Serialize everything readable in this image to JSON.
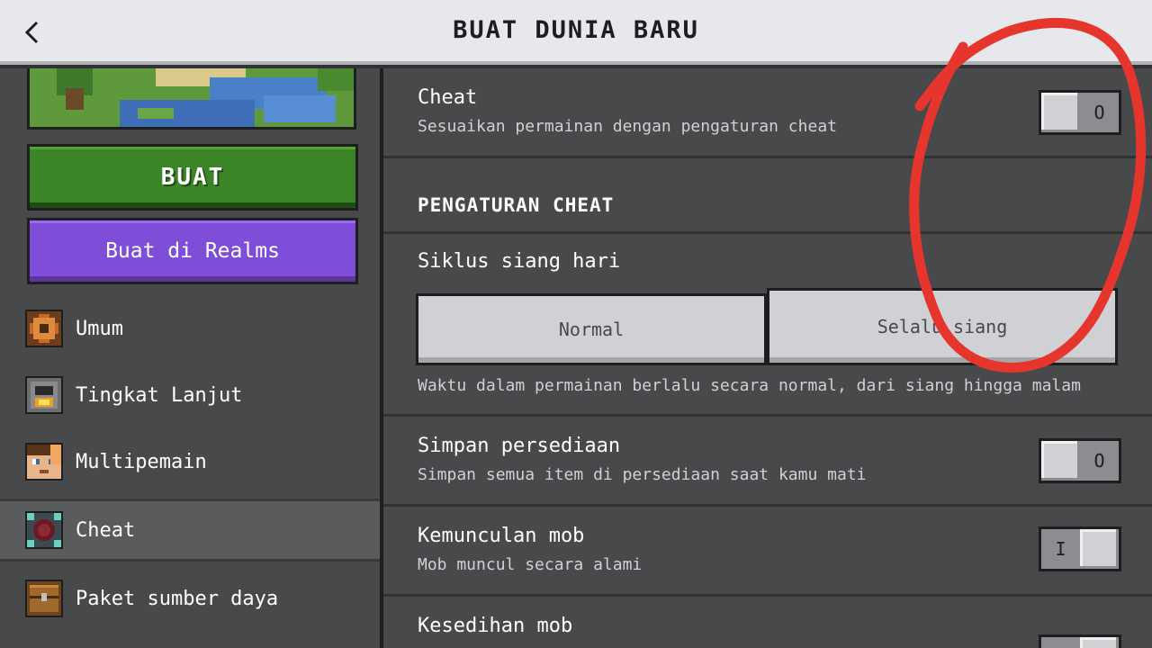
{
  "header": {
    "title": "BUAT DUNIA BARU",
    "back_icon": "chevron-left-icon"
  },
  "sidebar": {
    "create_label": "BUAT",
    "realms_label": "Buat di Realms",
    "items": [
      {
        "label": "Umum",
        "icon": "gear-icon",
        "active": false
      },
      {
        "label": "Tingkat Lanjut",
        "icon": "furnace-icon",
        "active": false
      },
      {
        "label": "Multipemain",
        "icon": "player-head-icon",
        "active": false
      },
      {
        "label": "Cheat",
        "icon": "command-block-icon",
        "active": true
      },
      {
        "label": "Paket sumber daya",
        "icon": "chest-icon",
        "active": false
      }
    ]
  },
  "settings": {
    "cheat": {
      "title": "Cheat",
      "desc": "Sesuaikan permainan dengan pengaturan cheat",
      "toggle_symbol": "O",
      "enabled": false
    },
    "section_title": "PENGATURAN CHEAT",
    "daylight": {
      "title": "Siklus siang hari",
      "options": [
        "Normal",
        "Selalu siang"
      ],
      "desc": "Waktu dalam permainan berlalu secara normal, dari siang hingga malam"
    },
    "keep_inventory": {
      "title": "Simpan persediaan",
      "desc": "Simpan semua item di persediaan saat kamu mati",
      "toggle_symbol": "O",
      "enabled": false
    },
    "mob_spawning": {
      "title": "Kemunculan mob",
      "desc": "Mob muncul secara alami",
      "toggle_symbol": "I",
      "enabled": true
    },
    "mob_griefing": {
      "title": "Kesedihan mob",
      "desc": "",
      "enabled": true
    }
  },
  "colors": {
    "annotation": "#e5352d",
    "create_green": "#3c8527",
    "realms_purple": "#7f4ed8"
  }
}
